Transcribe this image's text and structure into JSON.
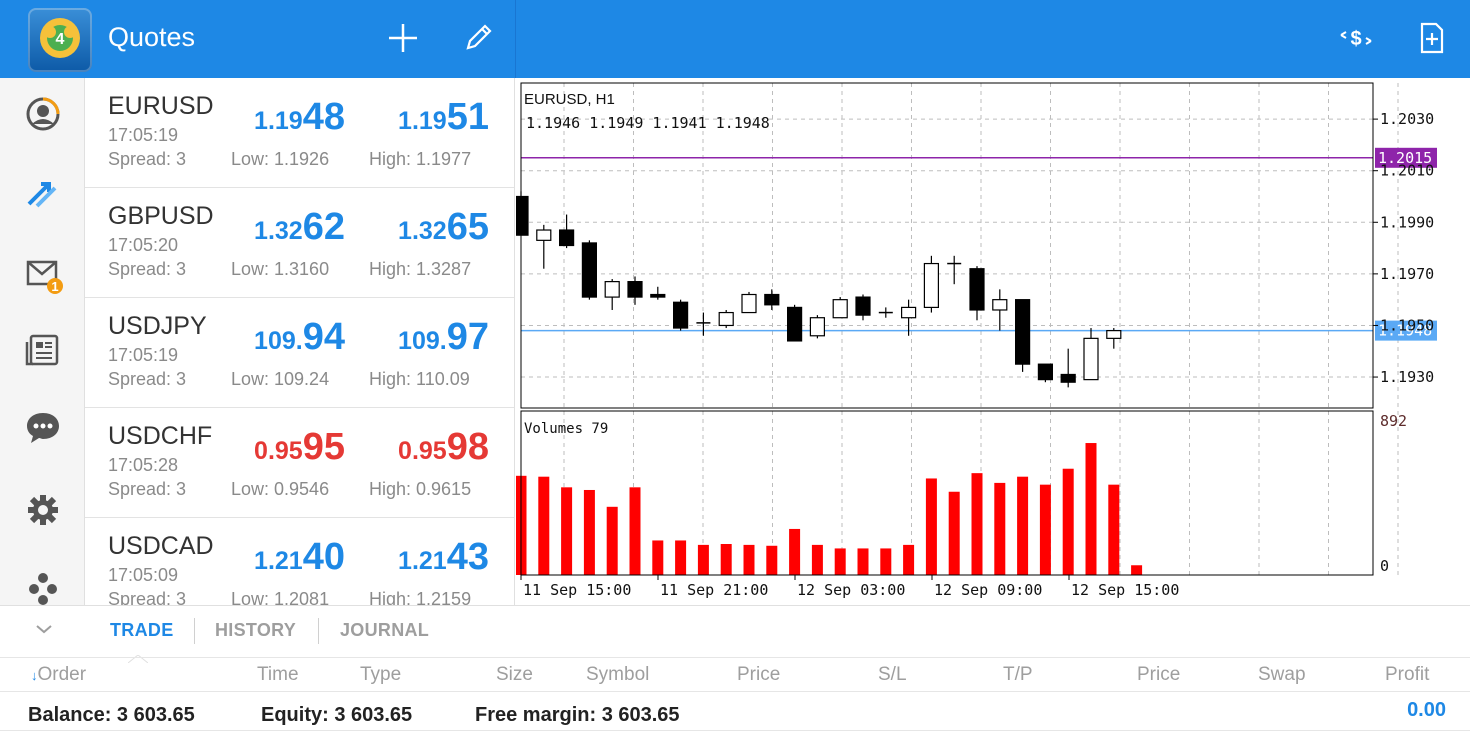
{
  "header": {
    "title": "Quotes",
    "icons": [
      "app-logo",
      "add-icon",
      "edit-icon",
      "trade-dollar-icon",
      "new-order-icon"
    ],
    "color": "#1e88e5"
  },
  "sidebar": {
    "items": [
      {
        "icon": "account-icon"
      },
      {
        "icon": "trade-icon"
      },
      {
        "icon": "mail-icon",
        "badge": "1"
      },
      {
        "icon": "news-icon"
      },
      {
        "icon": "chat-icon"
      },
      {
        "icon": "settings-icon"
      },
      {
        "icon": "community-icon"
      }
    ]
  },
  "quotes": [
    {
      "symbol": "EURUSD",
      "time": "17:05:19",
      "spread": "Spread: 3",
      "bid_small": "1.19",
      "bid_big": "48",
      "ask_small": "1.19",
      "ask_big": "51",
      "low": "Low: 1.1926",
      "high": "High: 1.1977",
      "color": "#1e88e5"
    },
    {
      "symbol": "GBPUSD",
      "time": "17:05:20",
      "spread": "Spread: 3",
      "bid_small": "1.32",
      "bid_big": "62",
      "ask_small": "1.32",
      "ask_big": "65",
      "low": "Low: 1.3160",
      "high": "High: 1.3287",
      "color": "#1e88e5"
    },
    {
      "symbol": "USDJPY",
      "time": "17:05:19",
      "spread": "Spread: 3",
      "bid_small": "109.",
      "bid_big": "94",
      "ask_small": "109.",
      "ask_big": "97",
      "low": "Low: 109.24",
      "high": "High: 110.09",
      "color": "#1e88e5"
    },
    {
      "symbol": "USDCHF",
      "time": "17:05:28",
      "spread": "Spread: 3",
      "bid_small": "0.95",
      "bid_big": "95",
      "ask_small": "0.95",
      "ask_big": "98",
      "low": "Low: 0.9546",
      "high": "High: 0.9615",
      "color": "#e53935"
    },
    {
      "symbol": "USDCAD",
      "time": "17:05:09",
      "spread": "Spread: 3",
      "bid_small": "1.21",
      "bid_big": "40",
      "ask_small": "1.21",
      "ask_big": "43",
      "low": "Low: 1.2081",
      "high": "High: 1.2159",
      "color": "#1e88e5"
    }
  ],
  "chart_data": {
    "type": "candlestick",
    "title": "EURUSD, H1",
    "ohlc_label": "1.1946 1.1949 1.1941 1.1948",
    "ylim": [
      1.1918,
      1.2044
    ],
    "y_ticks": [
      "1.2030",
      "1.2010",
      "1.1990",
      "1.1970",
      "1.1950",
      "1.1930"
    ],
    "levels": [
      {
        "value": 1.2015,
        "label": "1.2015",
        "color": "#8e24aa"
      },
      {
        "value": 1.1948,
        "label": "1.1948",
        "color": "#5aa9f5"
      }
    ],
    "x_labels": [
      "11 Sep 15:00",
      "11 Sep 21:00",
      "12 Sep 03:00",
      "12 Sep 09:00",
      "12 Sep 15:00"
    ],
    "candles": [
      {
        "o": 1.2,
        "h": 1.2002,
        "l": 1.1985,
        "c": 1.1985
      },
      {
        "o": 1.1983,
        "h": 1.1989,
        "l": 1.1972,
        "c": 1.1987
      },
      {
        "o": 1.1987,
        "h": 1.1993,
        "l": 1.198,
        "c": 1.1981
      },
      {
        "o": 1.1982,
        "h": 1.1983,
        "l": 1.196,
        "c": 1.1961
      },
      {
        "o": 1.1961,
        "h": 1.1968,
        "l": 1.1956,
        "c": 1.1967
      },
      {
        "o": 1.1967,
        "h": 1.1969,
        "l": 1.1958,
        "c": 1.1961
      },
      {
        "o": 1.1962,
        "h": 1.1965,
        "l": 1.196,
        "c": 1.1961
      },
      {
        "o": 1.1959,
        "h": 1.196,
        "l": 1.1948,
        "c": 1.1949
      },
      {
        "o": 1.1951,
        "h": 1.1955,
        "l": 1.1946,
        "c": 1.1951
      },
      {
        "o": 1.195,
        "h": 1.1956,
        "l": 1.1949,
        "c": 1.1955
      },
      {
        "o": 1.1955,
        "h": 1.1963,
        "l": 1.1955,
        "c": 1.1962
      },
      {
        "o": 1.1962,
        "h": 1.1964,
        "l": 1.1956,
        "c": 1.1958
      },
      {
        "o": 1.1957,
        "h": 1.1958,
        "l": 1.1944,
        "c": 1.1944
      },
      {
        "o": 1.1946,
        "h": 1.1954,
        "l": 1.1945,
        "c": 1.1953
      },
      {
        "o": 1.1953,
        "h": 1.1961,
        "l": 1.1953,
        "c": 1.196
      },
      {
        "o": 1.1961,
        "h": 1.1962,
        "l": 1.1952,
        "c": 1.1954
      },
      {
        "o": 1.1955,
        "h": 1.1957,
        "l": 1.1953,
        "c": 1.1955
      },
      {
        "o": 1.1953,
        "h": 1.196,
        "l": 1.1946,
        "c": 1.1957
      },
      {
        "o": 1.1957,
        "h": 1.1977,
        "l": 1.1955,
        "c": 1.1974
      },
      {
        "o": 1.1974,
        "h": 1.1977,
        "l": 1.1966,
        "c": 1.1974
      },
      {
        "o": 1.1972,
        "h": 1.1973,
        "l": 1.1952,
        "c": 1.1956
      },
      {
        "o": 1.1956,
        "h": 1.1964,
        "l": 1.1948,
        "c": 1.196
      },
      {
        "o": 1.196,
        "h": 1.196,
        "l": 1.1932,
        "c": 1.1935
      },
      {
        "o": 1.1935,
        "h": 1.1935,
        "l": 1.1928,
        "c": 1.1929
      },
      {
        "o": 1.1931,
        "h": 1.1941,
        "l": 1.1926,
        "c": 1.1928
      },
      {
        "o": 1.1929,
        "h": 1.1949,
        "l": 1.1929,
        "c": 1.1945
      },
      {
        "o": 1.1945,
        "h": 1.1949,
        "l": 1.1941,
        "c": 1.1948
      }
    ],
    "volumes_label": "Volumes 79",
    "volume_ticks": [
      "892",
      "0"
    ],
    "volume_max": 892,
    "volumes": [
      560,
      555,
      495,
      480,
      385,
      495,
      195,
      195,
      170,
      175,
      170,
      165,
      260,
      170,
      150,
      150,
      150,
      170,
      545,
      470,
      575,
      520,
      555,
      510,
      600,
      745,
      510,
      55
    ]
  },
  "bottom": {
    "tabs": [
      "TRADE",
      "HISTORY",
      "JOURNAL"
    ],
    "columns": [
      "Order",
      "Time",
      "Type",
      "Size",
      "Symbol",
      "Price",
      "S/L",
      "T/P",
      "Price",
      "Swap",
      "Profit"
    ],
    "balance": "Balance: 3 603.65",
    "equity": "Equity: 3 603.65",
    "free_margin": "Free margin: 3 603.65",
    "profit": "0.00"
  }
}
